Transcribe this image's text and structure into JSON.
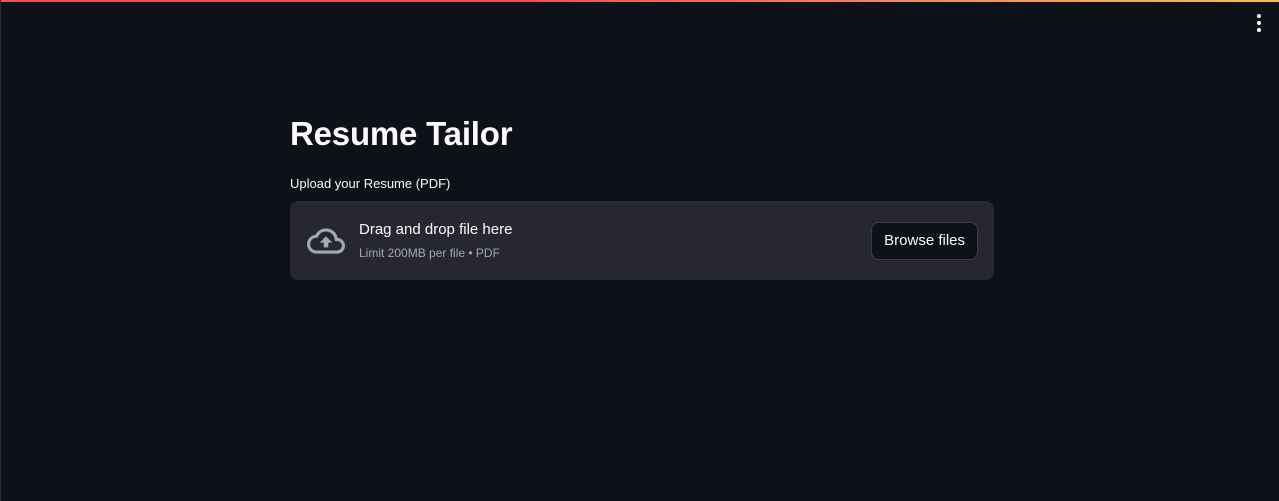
{
  "header": {
    "menu_icon": "vertical-dots-icon"
  },
  "main": {
    "title": "Resume Tailor",
    "uploader": {
      "label": "Upload your Resume (PDF)",
      "icon": "cloud-upload-icon",
      "instructions": "Drag and drop file here",
      "limit": "Limit 200MB per file • PDF",
      "browse_label": "Browse files"
    }
  },
  "colors": {
    "background": "#0e1117",
    "dropzone": "#262730",
    "accent_start": "#ff4b4b",
    "accent_end": "#ffbd45",
    "secondary_text": "#a3a8b8"
  }
}
